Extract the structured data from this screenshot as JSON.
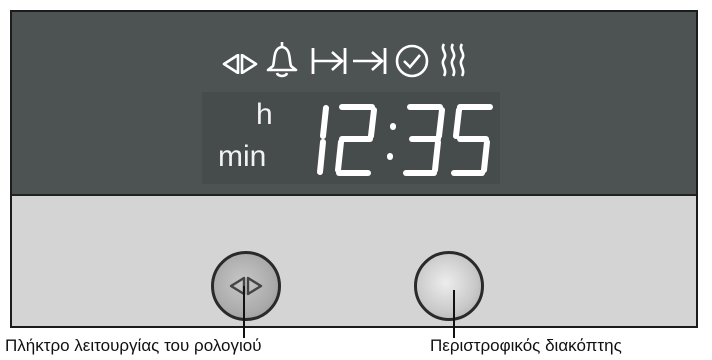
{
  "display": {
    "time_digits": "12:35",
    "unit_hours": "h",
    "unit_minutes": "min",
    "symbols": [
      "clock-function-arrows-icon",
      "bell-icon",
      "cooking-time-icon",
      "end-time-icon",
      "clock-check-icon",
      "heating-icon"
    ]
  },
  "buttons": {
    "clock_button": {
      "icon": "clock-function-arrows-icon"
    },
    "rotary_knob": {}
  },
  "labels": {
    "clock_button_label": "Πλήκτρο λειτουργίας του ρολογιού",
    "rotary_label": "Περιστροφικός διακόπτης"
  },
  "colors": {
    "display_bg": "#4d5253",
    "panel_bg": "#d4d4d4",
    "segment": "#ffffff"
  }
}
